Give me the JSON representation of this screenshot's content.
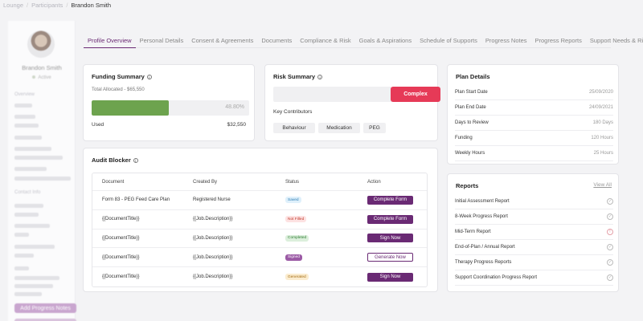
{
  "breadcrumb": {
    "root": "Lounge",
    "parent": "Participants",
    "current": "Brandon Smith"
  },
  "sidebar": {
    "name": "Brandon Smith",
    "status": "Active",
    "overview": "Overview",
    "contact_info": "Contact Info",
    "add_note_button": "Add Progress Notes"
  },
  "tabs": [
    "Profile Overview",
    "Personal Details",
    "Consent & Agreements",
    "Documents",
    "Compliance & Risk",
    "Goals & Aspirations",
    "Schedule of Supports",
    "Progress Notes",
    "Progress Reports",
    "Support Needs & Risk Profile"
  ],
  "funding": {
    "title": "Funding Summary",
    "total_allocated": "Total Allocated - $65,550",
    "percent_text": "48.80%",
    "percent_value": 48.8,
    "used_label": "Used",
    "used_value": "$32,550"
  },
  "risk": {
    "title": "Risk Summary",
    "level": "Complex",
    "contributors_label": "Key Contributors",
    "contributors": [
      "Behaviour",
      "Medication",
      "PEG"
    ]
  },
  "audit": {
    "title": "Audit Blocker",
    "headers": [
      "Document",
      "Created By",
      "Status",
      "Action"
    ],
    "rows": [
      {
        "document": "Form 83 - PEG Feed Care Plan",
        "created_by": "Registered Nurse",
        "status": "Saved",
        "action": "Complete Form"
      },
      {
        "document": "{{DocumentTitle}}",
        "created_by": "{{Job.Description}}",
        "status": "Not Filled",
        "action": "Complete Form"
      },
      {
        "document": "{{DocumentTitle}}",
        "created_by": "{{Job.Description}}",
        "status": "Completed",
        "action": "Sign Now"
      },
      {
        "document": "{{DocumentTitle}}",
        "created_by": "{{Job.Description}}",
        "status": "Signed",
        "action": "Generate Now"
      },
      {
        "document": "{{DocumentTitle}}",
        "created_by": "{{Job.Description}}",
        "status": "Generated",
        "action": "Sign Now"
      }
    ]
  },
  "plan": {
    "title": "Plan Details",
    "rows": [
      {
        "label": "Plan Start Date",
        "value": "25/09/2020"
      },
      {
        "label": "Plan End Date",
        "value": "24/09/2021"
      },
      {
        "label": "Days to Review",
        "value": "180 Days"
      },
      {
        "label": "Funding",
        "value": "120 Hours"
      },
      {
        "label": "Weekly Hours",
        "value": "25 Hours"
      }
    ]
  },
  "reports": {
    "title": "Reports",
    "view_all": "View All",
    "items": [
      "Initial Assessment Report",
      "8-Week Progress Report",
      "Mid-Term Report",
      "End-of-Plan / Annual Report",
      "Therapy Progress Reports",
      "Support Coordination Progress Report"
    ]
  },
  "colors": {
    "accent": "#6a2a74",
    "danger": "#e63a57",
    "success": "#6da34e"
  }
}
